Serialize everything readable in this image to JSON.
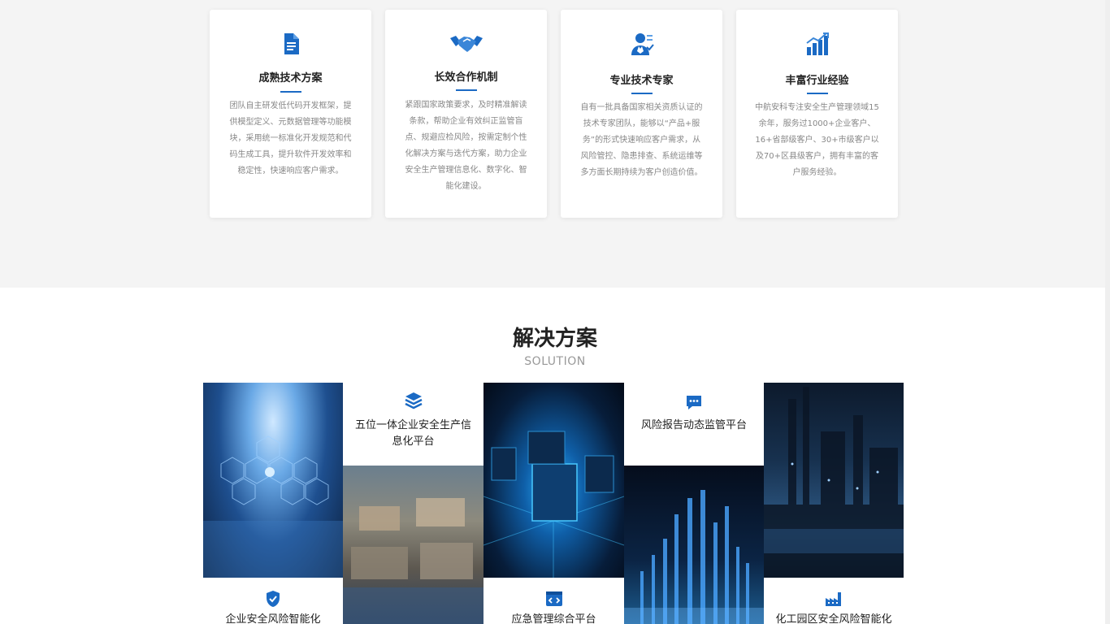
{
  "features": [
    {
      "icon": "document-icon",
      "title": "成熟技术方案",
      "desc": "团队自主研发低代码开发框架，提供模型定义、元数据管理等功能模块，采用统一标准化开发规范和代码生成工具，提升软件开发效率和稳定性，快速响应客户需求。"
    },
    {
      "icon": "handshake-icon",
      "title": "长效合作机制",
      "desc": "紧跟国家政策要求，及时精准解读条款，帮助企业有效纠正监管盲点、规避应检风险，按需定制个性化解决方案与迭代方案，助力企业安全生产管理信息化、数字化、智能化建设。"
    },
    {
      "icon": "expert-icon",
      "title": "专业技术专家",
      "desc": "自有一批具备国家相关资质认证的技术专家团队，能够以“产品+服务”的形式快速响应客户需求，从风险管控、隐患排查、系统运维等多方面长期持续为客户创造价值。"
    },
    {
      "icon": "growth-chart-icon",
      "title": "丰富行业经验",
      "desc": "中航安科专注安全生产管理领域15余年，服务过1000+企业客户、16+省部级客户、30+市级客户以及70+区县级客户，拥有丰富的客户服务经验。"
    }
  ],
  "solution": {
    "title": "解决方案",
    "subtitle": "SOLUTION",
    "items": [
      {
        "icon": "layers-icon",
        "label": "五位一体企业安全生产信息化平台"
      },
      {
        "icon": "chat-icon",
        "label": "风险报告动态监管平台"
      },
      {
        "icon": "shield-icon",
        "label": "企业安全风险智能化"
      },
      {
        "icon": "code-window-icon",
        "label": "应急管理综合平台"
      },
      {
        "icon": "factory-icon",
        "label": "化工园区安全风险智能化"
      }
    ]
  },
  "colors": {
    "accent": "#1b6ac4",
    "band": "#f4f4f4"
  }
}
